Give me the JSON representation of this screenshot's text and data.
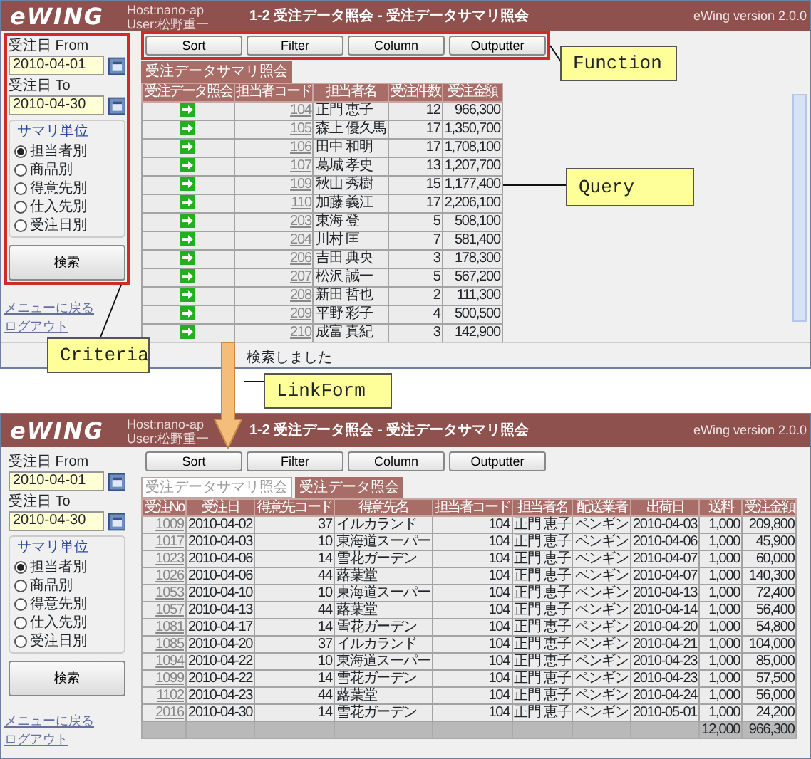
{
  "screens": [
    {
      "highlighted": true,
      "header": {
        "logo": "eWING",
        "host": "Host:nano-ap",
        "user": "User:松野重一",
        "title": "1-2 受注データ照会 - 受注データサマリ照会",
        "version": "eWing version 2.0.0"
      },
      "criteria": {
        "from_label": "受注日 From",
        "from_value": "2010-04-01",
        "to_label": "受注日 To",
        "to_value": "2010-04-30",
        "group_title": "サマリ単位",
        "options": [
          {
            "label": "担当者別",
            "selected": true
          },
          {
            "label": "商品別",
            "selected": false
          },
          {
            "label": "得意先別",
            "selected": false
          },
          {
            "label": "仕入先別",
            "selected": false
          },
          {
            "label": "受注日別",
            "selected": false
          }
        ],
        "search_button": "検索"
      },
      "links": [
        "メニューに戻る",
        "ログアウト"
      ],
      "function_buttons": [
        "Sort",
        "Filter",
        "Column",
        "Outputter"
      ],
      "tabs": [
        {
          "label": "受注データサマリ照会",
          "selected": true
        }
      ],
      "table": {
        "columns": [
          {
            "label": "受注データ照会",
            "kind": "icon"
          },
          {
            "label": "担当者コード",
            "kind": "link"
          },
          {
            "label": "担当者名",
            "kind": "text"
          },
          {
            "label": "受注件数",
            "kind": "number"
          },
          {
            "label": "受注金額",
            "kind": "number"
          }
        ],
        "rows": [
          [
            "",
            "104",
            "正門 恵子",
            "12",
            "966,300"
          ],
          [
            "",
            "105",
            "森上 優久馬",
            "17",
            "1,350,700"
          ],
          [
            "",
            "106",
            "田中 和明",
            "17",
            "1,708,100"
          ],
          [
            "",
            "107",
            "葛城 孝史",
            "13",
            "1,207,700"
          ],
          [
            "",
            "109",
            "秋山 秀樹",
            "15",
            "1,177,400"
          ],
          [
            "",
            "110",
            "加藤 義江",
            "17",
            "2,206,100"
          ],
          [
            "",
            "203",
            "東海 登",
            "5",
            "508,100"
          ],
          [
            "",
            "204",
            "川村 匡",
            "7",
            "581,400"
          ],
          [
            "",
            "206",
            "吉田 典央",
            "3",
            "178,300"
          ],
          [
            "",
            "207",
            "松沢 誠一",
            "5",
            "567,200"
          ],
          [
            "",
            "208",
            "新田 哲也",
            "2",
            "111,300"
          ],
          [
            "",
            "209",
            "平野 彩子",
            "4",
            "500,500"
          ],
          [
            "",
            "210",
            "成富 真紀",
            "3",
            "142,900"
          ]
        ]
      },
      "status": "検索しました"
    },
    {
      "highlighted": false,
      "header": {
        "logo": "eWING",
        "host": "Host:nano-ap",
        "user": "User:松野重一",
        "title": "1-2 受注データ照会 - 受注データサマリ照会",
        "version": "eWing version 2.0.0"
      },
      "criteria": {
        "from_label": "受注日 From",
        "from_value": "2010-04-01",
        "to_label": "受注日 To",
        "to_value": "2010-04-30",
        "group_title": "サマリ単位",
        "options": [
          {
            "label": "担当者別",
            "selected": true
          },
          {
            "label": "商品別",
            "selected": false
          },
          {
            "label": "得意先別",
            "selected": false
          },
          {
            "label": "仕入先別",
            "selected": false
          },
          {
            "label": "受注日別",
            "selected": false
          }
        ],
        "search_button": "検索"
      },
      "links": [
        "メニューに戻る",
        "ログアウト"
      ],
      "function_buttons": [
        "Sort",
        "Filter",
        "Column",
        "Outputter"
      ],
      "tabs": [
        {
          "label": "受注データサマリ照会",
          "selected": false
        },
        {
          "label": "受注データ照会",
          "selected": true
        }
      ],
      "table": {
        "columns": [
          {
            "label": "受注No",
            "kind": "link"
          },
          {
            "label": "受注日",
            "kind": "text"
          },
          {
            "label": "得意先コード",
            "kind": "number"
          },
          {
            "label": "得意先名",
            "kind": "text"
          },
          {
            "label": "担当者コード",
            "kind": "number"
          },
          {
            "label": "担当者名",
            "kind": "text"
          },
          {
            "label": "配送業者",
            "kind": "text"
          },
          {
            "label": "出荷日",
            "kind": "text"
          },
          {
            "label": "送料",
            "kind": "number"
          },
          {
            "label": "受注金額",
            "kind": "number"
          }
        ],
        "rows": [
          [
            "1009",
            "2010-04-02",
            "37",
            "イルカランド",
            "104",
            "正門 恵子",
            "ペンギン",
            "2010-04-03",
            "1,000",
            "209,800"
          ],
          [
            "1017",
            "2010-04-03",
            "10",
            "東海道スーパー",
            "104",
            "正門 恵子",
            "ペンギン",
            "2010-04-06",
            "1,000",
            "45,900"
          ],
          [
            "1023",
            "2010-04-06",
            "14",
            "雪花ガーデン",
            "104",
            "正門 恵子",
            "ペンギン",
            "2010-04-07",
            "1,000",
            "60,000"
          ],
          [
            "1026",
            "2010-04-06",
            "44",
            "蕗葉堂",
            "104",
            "正門 恵子",
            "ペンギン",
            "2010-04-07",
            "1,000",
            "140,300"
          ],
          [
            "1053",
            "2010-04-10",
            "10",
            "東海道スーパー",
            "104",
            "正門 恵子",
            "ペンギン",
            "2010-04-13",
            "1,000",
            "72,400"
          ],
          [
            "1057",
            "2010-04-13",
            "44",
            "蕗葉堂",
            "104",
            "正門 恵子",
            "ペンギン",
            "2010-04-14",
            "1,000",
            "56,400"
          ],
          [
            "1081",
            "2010-04-17",
            "14",
            "雪花ガーデン",
            "104",
            "正門 恵子",
            "ペンギン",
            "2010-04-20",
            "1,000",
            "54,800"
          ],
          [
            "1085",
            "2010-04-20",
            "37",
            "イルカランド",
            "104",
            "正門 恵子",
            "ペンギン",
            "2010-04-21",
            "1,000",
            "104,000"
          ],
          [
            "1094",
            "2010-04-22",
            "10",
            "東海道スーパー",
            "104",
            "正門 恵子",
            "ペンギン",
            "2010-04-23",
            "1,000",
            "85,000"
          ],
          [
            "1099",
            "2010-04-22",
            "14",
            "雪花ガーデン",
            "104",
            "正門 恵子",
            "ペンギン",
            "2010-04-23",
            "1,000",
            "57,500"
          ],
          [
            "1102",
            "2010-04-23",
            "44",
            "蕗葉堂",
            "104",
            "正門 恵子",
            "ペンギン",
            "2010-04-24",
            "1,000",
            "56,000"
          ],
          [
            "2016",
            "2010-04-30",
            "14",
            "雪花ガーデン",
            "104",
            "正門 恵子",
            "ペンギン",
            "2010-05-01",
            "1,000",
            "24,200"
          ]
        ],
        "totals": [
          "12,000",
          "966,300"
        ]
      }
    }
  ],
  "callouts": [
    {
      "label": "Function"
    },
    {
      "label": "Query"
    },
    {
      "label": "Criteria"
    },
    {
      "label": "LinkForm"
    }
  ]
}
